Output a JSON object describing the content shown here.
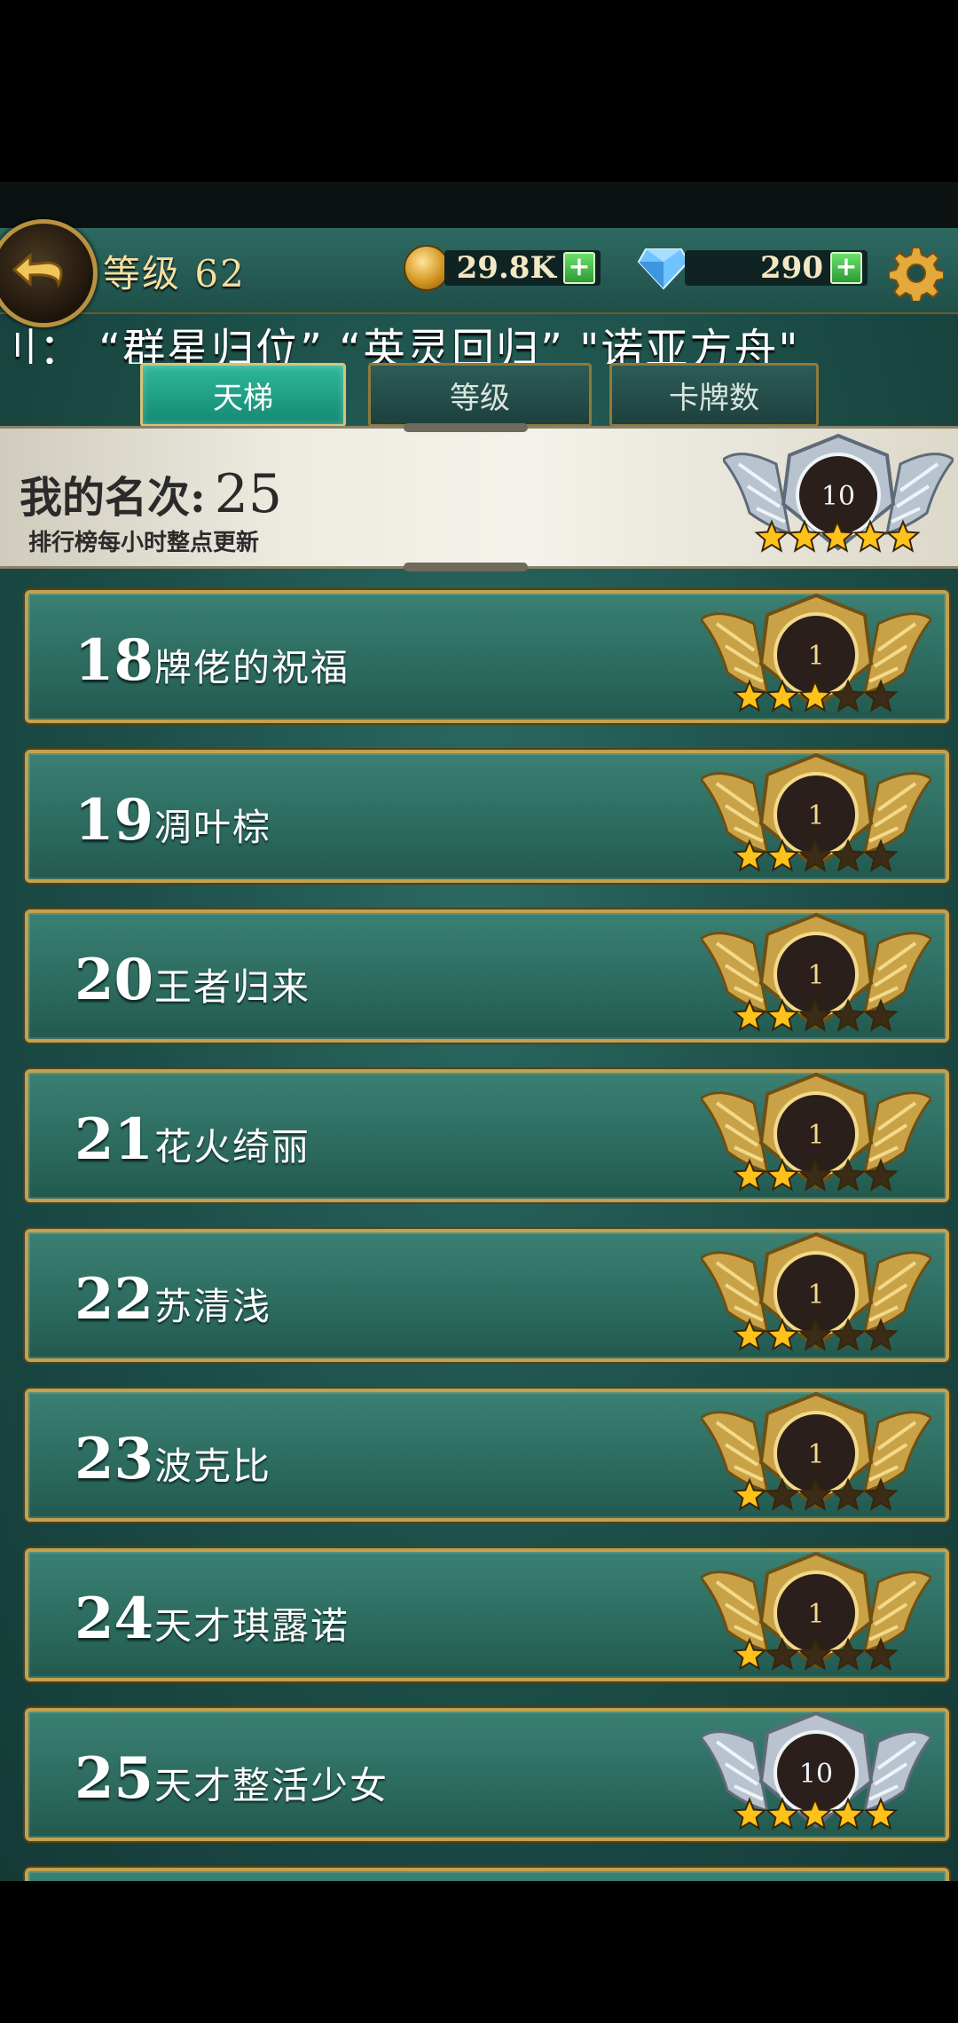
{
  "hud": {
    "level_label": "等级 62",
    "coins": "29.8K",
    "gems": "290",
    "plus": "+"
  },
  "marquee": "刂：  “群星归位”   “英灵回归”  \"诺亚方舟\"",
  "tabs": [
    {
      "label": "天梯",
      "active": true
    },
    {
      "label": "等级",
      "active": false
    },
    {
      "label": "卡牌数",
      "active": false
    }
  ],
  "my_rank": {
    "label": "我的名次:",
    "value": "25",
    "note": "排行榜每小时整点更新",
    "badge": {
      "tier": "silver",
      "level": "10",
      "stars": 5
    }
  },
  "rows": [
    {
      "rank": "18",
      "name": "牌佬的祝福",
      "badge": {
        "tier": "gold",
        "level": "1",
        "stars": 3
      }
    },
    {
      "rank": "19",
      "name": "凋叶棕",
      "badge": {
        "tier": "gold",
        "level": "1",
        "stars": 2
      }
    },
    {
      "rank": "20",
      "name": "王者归来",
      "badge": {
        "tier": "gold",
        "level": "1",
        "stars": 2
      }
    },
    {
      "rank": "21",
      "name": "花火绮丽",
      "badge": {
        "tier": "gold",
        "level": "1",
        "stars": 2
      }
    },
    {
      "rank": "22",
      "name": "苏清浅",
      "badge": {
        "tier": "gold",
        "level": "1",
        "stars": 2
      }
    },
    {
      "rank": "23",
      "name": "波克比",
      "badge": {
        "tier": "gold",
        "level": "1",
        "stars": 1
      }
    },
    {
      "rank": "24",
      "name": "天才琪露诺",
      "badge": {
        "tier": "gold",
        "level": "1",
        "stars": 1
      }
    },
    {
      "rank": "25",
      "name": "天才整活少女",
      "badge": {
        "tier": "silver",
        "level": "10",
        "stars": 5
      }
    }
  ],
  "colors": {
    "gold_badge": "#c9a247",
    "silver_badge": "#b8c3cf",
    "star_on": "#ffc21a",
    "star_off": "#3b2c18"
  }
}
